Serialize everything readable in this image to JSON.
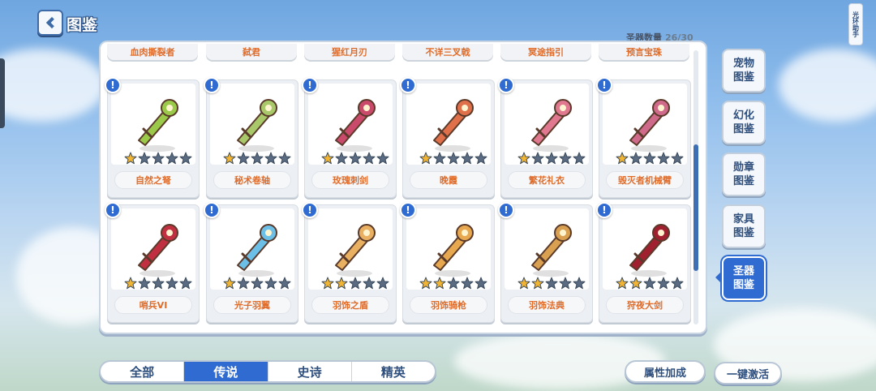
{
  "header": {
    "title": "图鉴"
  },
  "count": {
    "label": "圣器数量",
    "value": "26/30"
  },
  "helper_tag": "光环助手",
  "partial_row": [
    "血肉撕裂者",
    "弑君",
    "猩红月刃",
    "不详三叉戟",
    "冥途指引",
    "预言宝珠"
  ],
  "cards": [
    {
      "name": "自然之弩",
      "stars": 1,
      "color": "#9bc94a"
    },
    {
      "name": "秘术卷轴",
      "stars": 1,
      "color": "#a8c86a"
    },
    {
      "name": "玫瑰刺剑",
      "stars": 1,
      "color": "#c94a6b"
    },
    {
      "name": "晚霞",
      "stars": 1,
      "color": "#e0704a"
    },
    {
      "name": "繁花礼衣",
      "stars": 1,
      "color": "#e07890"
    },
    {
      "name": "毁灭者机械臂",
      "stars": 1,
      "color": "#d06a8a"
    },
    {
      "name": "哨兵VI",
      "stars": 1,
      "color": "#c03040"
    },
    {
      "name": "光子羽翼",
      "stars": 1,
      "color": "#6cc0e8"
    },
    {
      "name": "羽饰之盾",
      "stars": 2,
      "color": "#e8b060"
    },
    {
      "name": "羽饰骑枪",
      "stars": 2,
      "color": "#e8a850"
    },
    {
      "name": "羽饰法典",
      "stars": 2,
      "color": "#d8a050"
    },
    {
      "name": "狩夜大剑",
      "stars": 2,
      "color": "#a02030"
    }
  ],
  "side_menu": [
    {
      "label": "宠物图鉴",
      "line1": "宠物",
      "line2": "图鉴",
      "active": false
    },
    {
      "label": "幻化图鉴",
      "line1": "幻化",
      "line2": "图鉴",
      "active": false
    },
    {
      "label": "勋章图鉴",
      "line1": "勋章",
      "line2": "图鉴",
      "active": false
    },
    {
      "label": "家具图鉴",
      "line1": "家具",
      "line2": "图鉴",
      "active": false
    },
    {
      "label": "圣器图鉴",
      "line1": "圣器",
      "line2": "图鉴",
      "active": true
    }
  ],
  "tabs": [
    {
      "label": "全部",
      "active": false
    },
    {
      "label": "传说",
      "active": true
    },
    {
      "label": "史诗",
      "active": false
    },
    {
      "label": "精英",
      "active": false
    }
  ],
  "buttons": {
    "attribute_bonus": "属性加成",
    "one_click_activate": "一键激活"
  },
  "colors": {
    "accent": "#2f6bd1",
    "label_orange": "#e06c2a",
    "star_gold": "#f2b533",
    "star_empty": "#5a6b82"
  }
}
